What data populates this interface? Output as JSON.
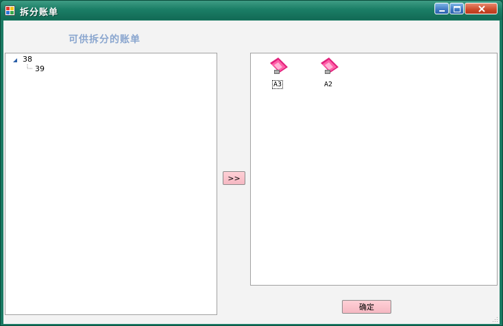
{
  "window": {
    "title": "拆分账单"
  },
  "caption": "可供拆分的账单",
  "tree": {
    "nodes": [
      {
        "label": "38",
        "expanded": true
      },
      {
        "label": "39"
      }
    ]
  },
  "move_button_label": ">>",
  "bills": [
    {
      "label": "A3",
      "selected": true,
      "icon": "pink-bill-icon"
    },
    {
      "label": "A2",
      "selected": false,
      "icon": "pink-bill-icon"
    }
  ],
  "confirm_label": "确定",
  "colors": {
    "titlebar": "#1b7e66",
    "accent_pink": "#f5b8c2",
    "caption": "#8aa6cf"
  }
}
